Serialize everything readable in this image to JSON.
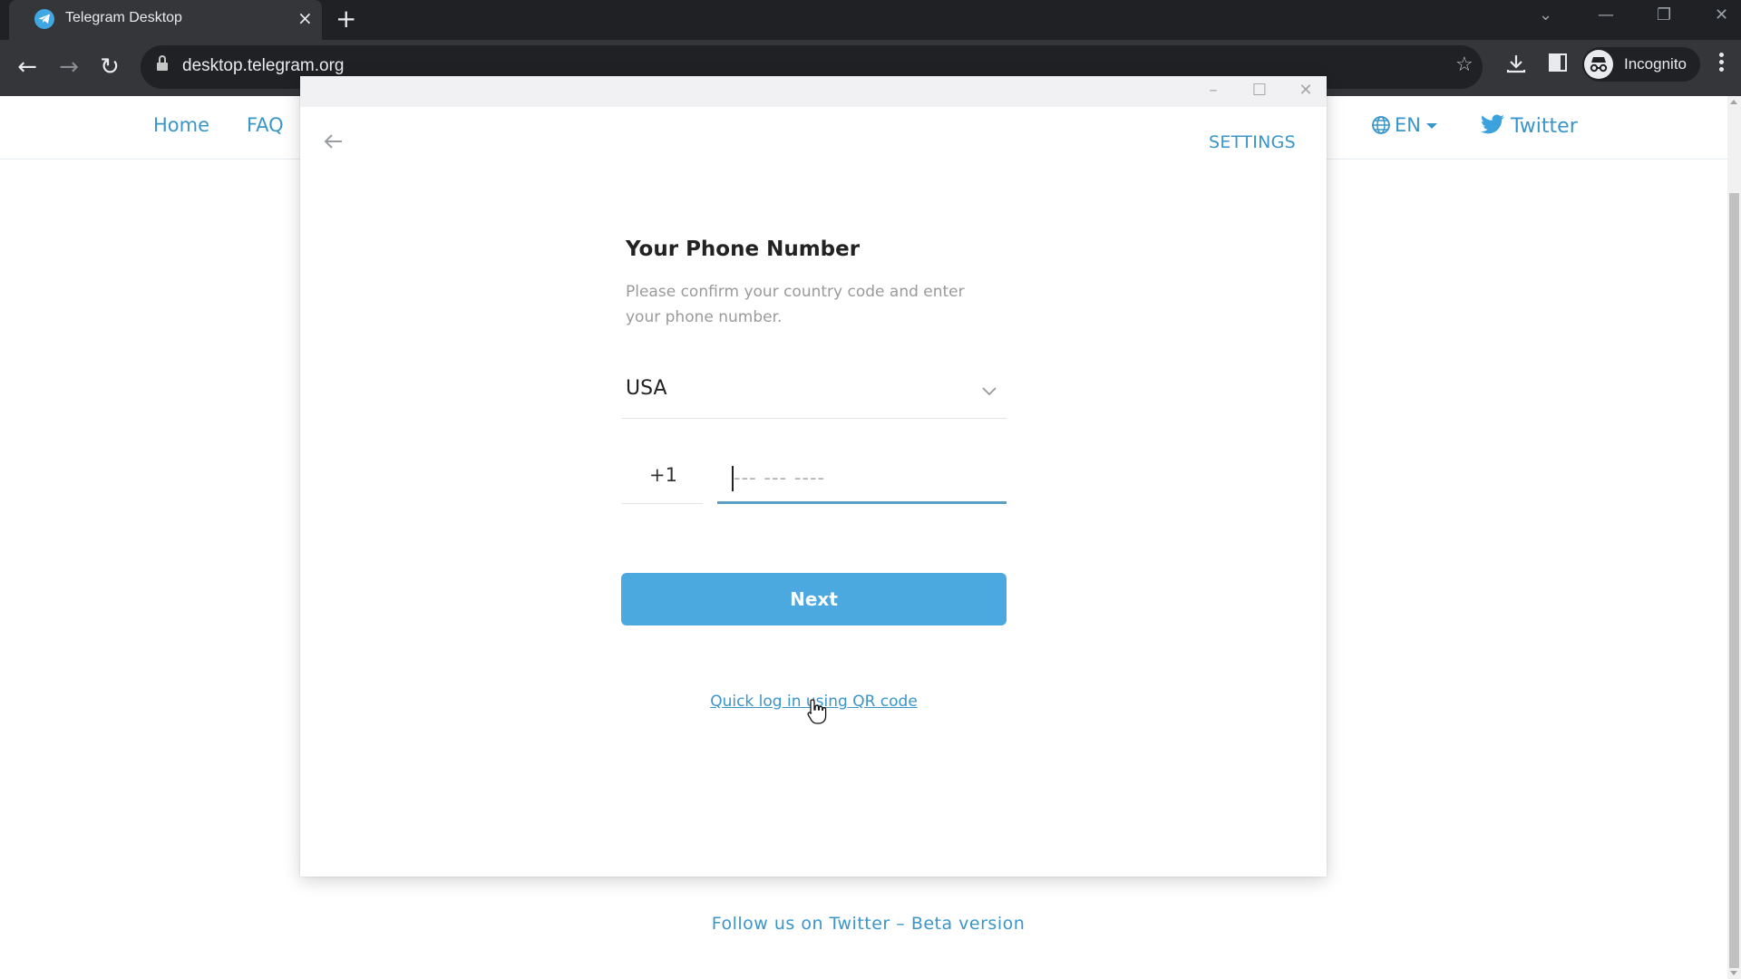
{
  "browser": {
    "tab": {
      "title": "Telegram Desktop",
      "close_glyph": "×"
    },
    "new_tab_glyph": "+",
    "window_controls": {
      "tabsearch": "⌄",
      "minimize": "—",
      "restore": "❐",
      "close": "✕"
    },
    "nav": {
      "back": "←",
      "forward": "→",
      "reload": "↻"
    },
    "url": "desktop.telegram.org",
    "star_glyph": "☆",
    "profile_label": "Incognito"
  },
  "page": {
    "nav_links": [
      "Home",
      "FAQ"
    ],
    "language": "EN",
    "twitter_label": "Twitter",
    "footer": {
      "twitter_link": "Follow us on Twitter",
      "separator": " – ",
      "beta_link": "Beta version"
    }
  },
  "modal": {
    "titlebar": {
      "minimize": "–",
      "maximize": "☐",
      "close": "✕"
    },
    "settings_label": "SETTINGS",
    "title": "Your Phone Number",
    "description": "Please confirm your country code and enter your phone number.",
    "country": "USA",
    "country_code": "+1",
    "phone_value": "",
    "phone_placeholder": "--- --- ----",
    "next_label": "Next",
    "qr_link": "Quick log in using QR code"
  },
  "colors": {
    "accent": "#4ca9e0",
    "link": "#3a95c9",
    "input_underline_active": "#5a9fc4"
  }
}
